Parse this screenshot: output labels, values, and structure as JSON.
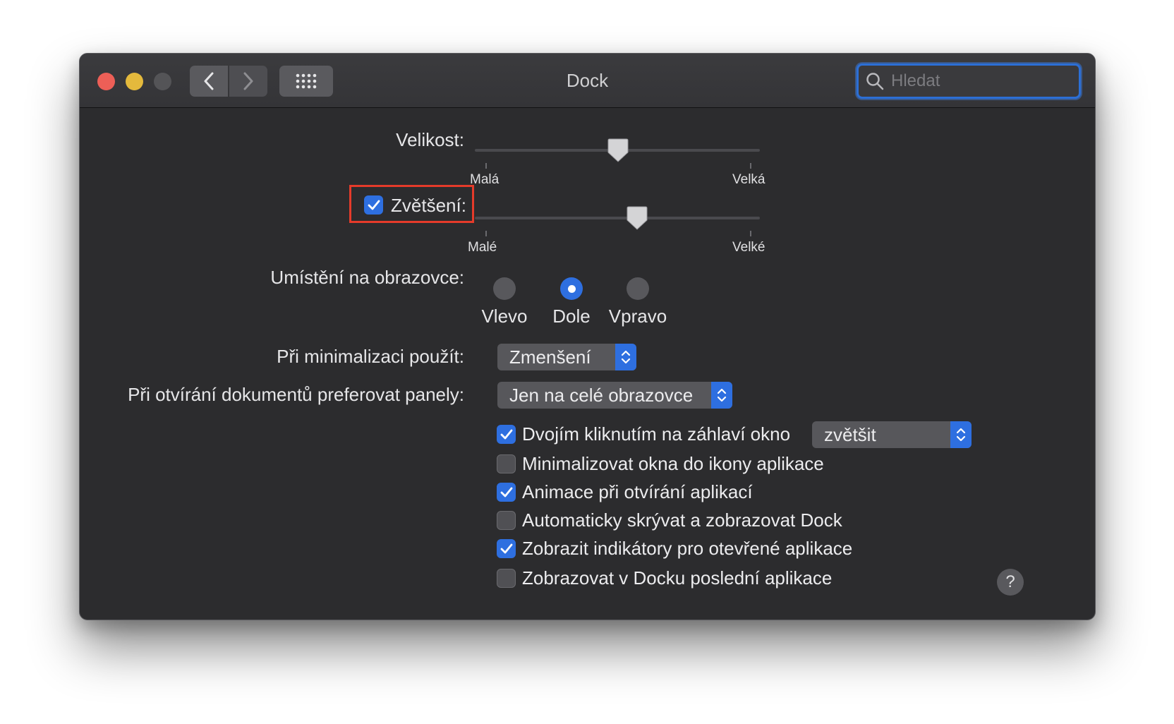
{
  "window": {
    "title": "Dock"
  },
  "search": {
    "placeholder": "Hledat",
    "value": ""
  },
  "size": {
    "label": "Velikost:",
    "min_label": "Malá",
    "max_label": "Velká",
    "value_fraction": 0.5
  },
  "magnification": {
    "label": "Zvětšení:",
    "checked": true,
    "min_label": "Malé",
    "max_label": "Velké",
    "value_fraction": 0.57
  },
  "position": {
    "label": "Umístění na obrazovce:",
    "options": [
      "Vlevo",
      "Dole",
      "Vpravo"
    ],
    "selected": "Dole"
  },
  "minimize": {
    "label": "Při minimalizaci použít:",
    "value": "Zmenšení"
  },
  "tabs": {
    "label": "Při otvírání dokumentů preferovat panely:",
    "value": "Jen na celé obrazovce"
  },
  "options": [
    {
      "label": "Dvojím kliknutím na záhlaví okno",
      "checked": true
    },
    {
      "label": "Minimalizovat okna do ikony aplikace",
      "checked": false
    },
    {
      "label": "Animace při otvírání aplikací",
      "checked": true
    },
    {
      "label": "Automaticky skrývat a zobrazovat Dock",
      "checked": false
    },
    {
      "label": "Zobrazit indikátory pro otevřené aplikace",
      "checked": true
    },
    {
      "label": "Zobrazovat v Docku poslední aplikace",
      "checked": false
    }
  ],
  "double_click_action": {
    "value": "zvětšit"
  },
  "help": {
    "label": "?"
  },
  "colors": {
    "accent": "#2e6fe0",
    "highlight": "#e53b2a",
    "background": "#2c2c2e"
  }
}
